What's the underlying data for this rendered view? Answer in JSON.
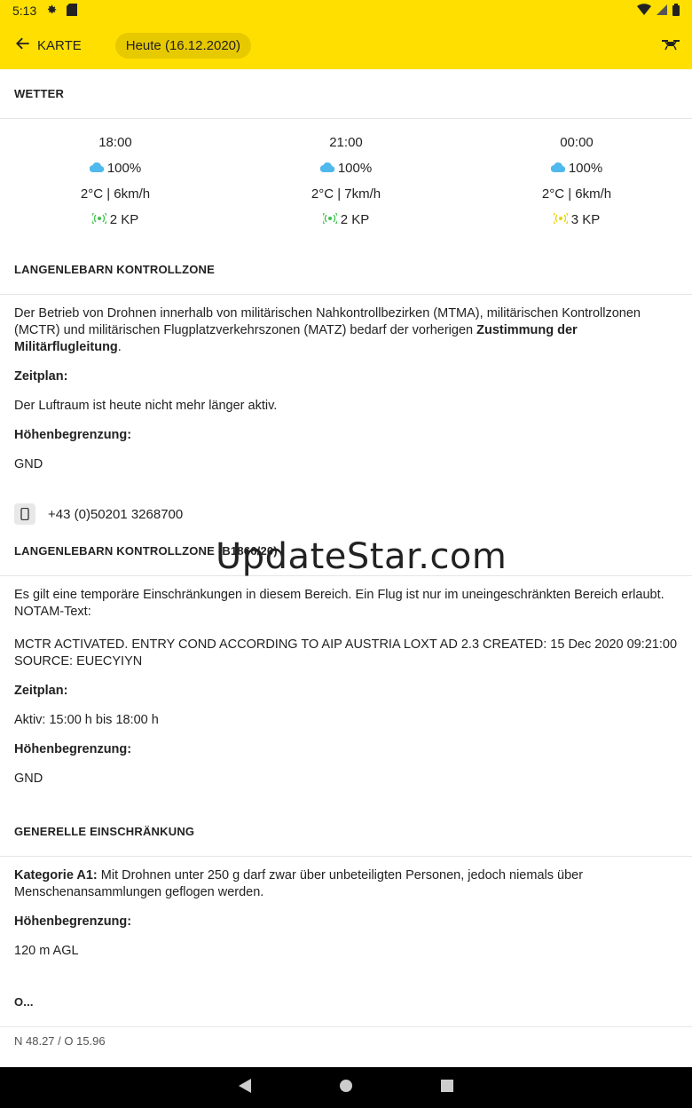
{
  "status": {
    "time": "5:13"
  },
  "appbar": {
    "back_label": "KARTE",
    "date_chip": "Heute (16.12.2020)"
  },
  "weather": {
    "title": "WETTER",
    "columns": [
      {
        "time": "18:00",
        "cloud": "100%",
        "temp_wind": "2°C | 6km/h",
        "kp": "2 KP",
        "kp_color": "#3DC04A"
      },
      {
        "time": "21:00",
        "cloud": "100%",
        "temp_wind": "2°C | 7km/h",
        "kp": "2 KP",
        "kp_color": "#3DC04A"
      },
      {
        "time": "00:00",
        "cloud": "100%",
        "temp_wind": "2°C | 6km/h",
        "kp": "3 KP",
        "kp_color": "#E8D400"
      }
    ]
  },
  "zone1": {
    "title": "LANGENLEBARN KONTROLLZONE",
    "text": "Der Betrieb von Drohnen innerhalb von militärischen Nahkontrollbezirken (MTMA), militärischen Kontrollzonen (MCTR) und militärischen Flugplatzverkehrszonen (MATZ) bedarf der vorherigen ",
    "text_bold": "Zustimmung der Militärflugleitung",
    "text_end": ".",
    "schedule_label": "Zeitplan:",
    "schedule": "Der Luftraum ist heute nicht mehr länger aktiv.",
    "height_label": "Höhenbegrenzung:",
    "height": "GND",
    "phone": "+43 (0)50201 3268700"
  },
  "zone2": {
    "title": "LANGENLEBARN KONTROLLZONE (B1866/20)",
    "text": "Es gilt eine temporäre Einschränkungen in diesem Bereich. Ein Flug ist nur im uneingeschränkten Bereich erlaubt.",
    "notam_label": "NOTAM-Text:",
    "notam": "MCTR ACTIVATED. ENTRY COND ACCORDING TO AIP AUSTRIA LOXT AD 2.3 CREATED: 15 Dec 2020 09:21:00 SOURCE: EUECYIYN",
    "schedule_label": "Zeitplan:",
    "schedule": "Aktiv: 15:00 h bis 18:00 h",
    "height_label": "Höhenbegrenzung:",
    "height": "GND"
  },
  "general": {
    "title": "GENERELLE EINSCHRÄNKUNG",
    "category_bold": "Kategorie A1:",
    "category_text": " Mit Drohnen unter 250 g darf zwar über unbeteiligten Personen, jedoch niemals über Menschenansammlungen geflogen werden.",
    "height_label": "Höhenbegrenzung:",
    "height": "120 m AGL"
  },
  "next_section": {
    "title": "O...",
    "coords": "N 48.27 / O 15.96"
  },
  "watermark": "UpdateStar.com",
  "colors": {
    "accent": "#FFDF00",
    "cloud": "#4FB8EC"
  }
}
